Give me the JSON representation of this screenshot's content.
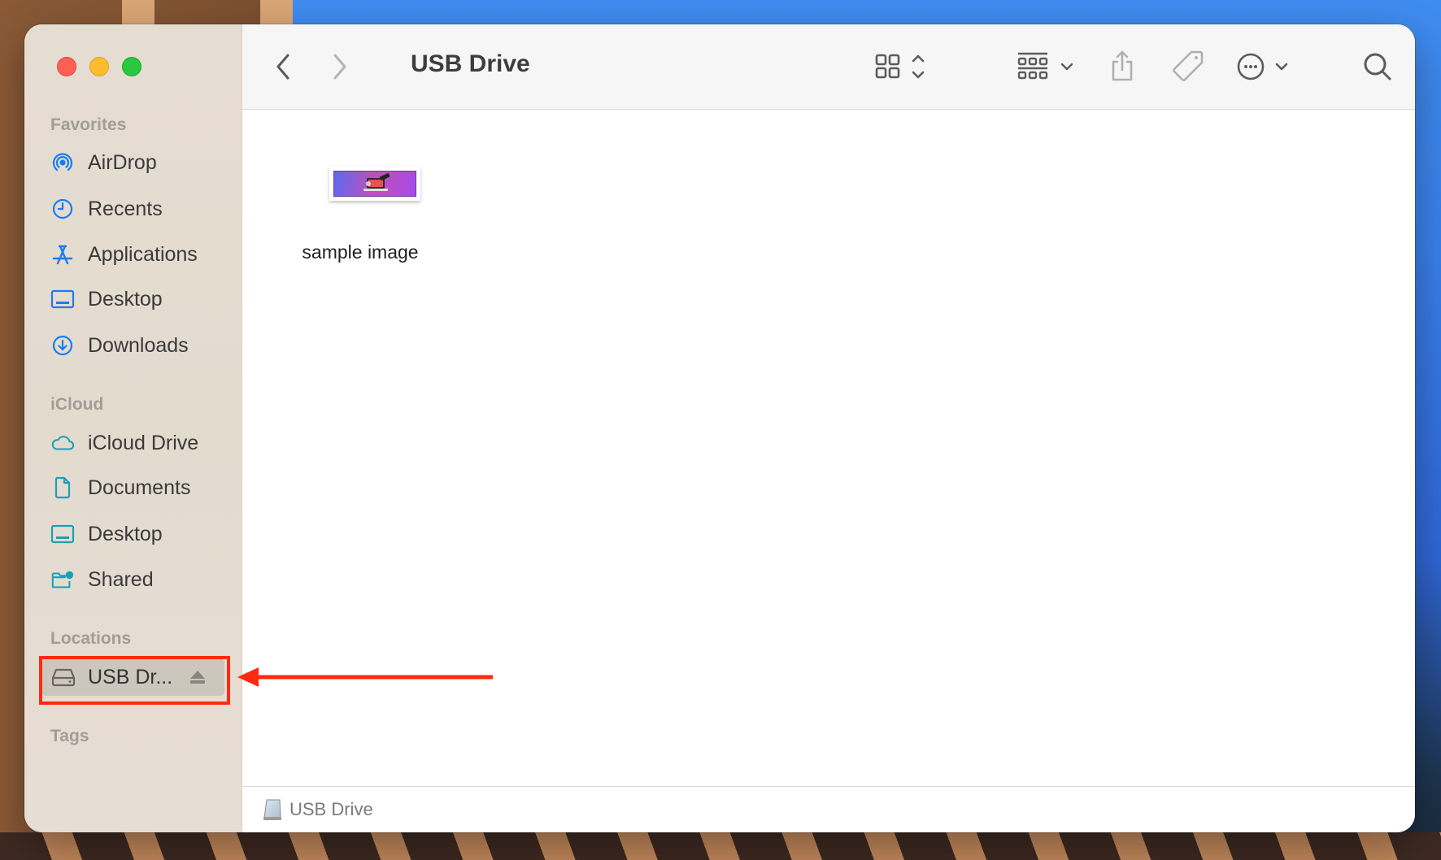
{
  "window": {
    "title": "USB Drive",
    "traffic_lights": [
      {
        "name": "close",
        "color": "#fe5f57"
      },
      {
        "name": "minimize",
        "color": "#febc2e"
      },
      {
        "name": "zoom",
        "color": "#28c840"
      }
    ]
  },
  "toolbar": {
    "back_icon": "chevron-left-icon",
    "forward_icon": "chevron-right-icon",
    "view_icon": "icon-grid-view-icon",
    "group_icon": "group-by-icon",
    "share_icon": "share-icon",
    "tag_icon": "tag-icon",
    "more_icon": "ellipsis-circle-icon",
    "search_icon": "search-icon"
  },
  "sidebar": {
    "sections": [
      {
        "header": "Favorites",
        "items": [
          {
            "label": "AirDrop",
            "icon": "airdrop-icon"
          },
          {
            "label": "Recents",
            "icon": "clock-icon"
          },
          {
            "label": "Applications",
            "icon": "applications-icon"
          },
          {
            "label": "Desktop",
            "icon": "desktop-icon"
          },
          {
            "label": "Downloads",
            "icon": "download-icon"
          }
        ]
      },
      {
        "header": "iCloud",
        "items": [
          {
            "label": "iCloud Drive",
            "icon": "cloud-icon"
          },
          {
            "label": "Documents",
            "icon": "document-icon"
          },
          {
            "label": "Desktop",
            "icon": "desktop-icon"
          },
          {
            "label": "Shared",
            "icon": "shared-folder-icon"
          }
        ]
      },
      {
        "header": "Locations",
        "items": [
          {
            "label": "USB Dr...",
            "icon": "drive-icon",
            "selected": true,
            "eject": true
          }
        ]
      },
      {
        "header": "Tags",
        "items": []
      }
    ],
    "favorites_color": "#1a7cf3",
    "icloud_color": "#1aa0b8"
  },
  "content": {
    "files": [
      {
        "name": "sample image",
        "type": "image"
      }
    ]
  },
  "footer": {
    "path_label": "USB Drive",
    "icon": "drive-icon"
  },
  "annotation": {
    "highlight_color": "#ff2a12",
    "target": "USB Dr..."
  }
}
